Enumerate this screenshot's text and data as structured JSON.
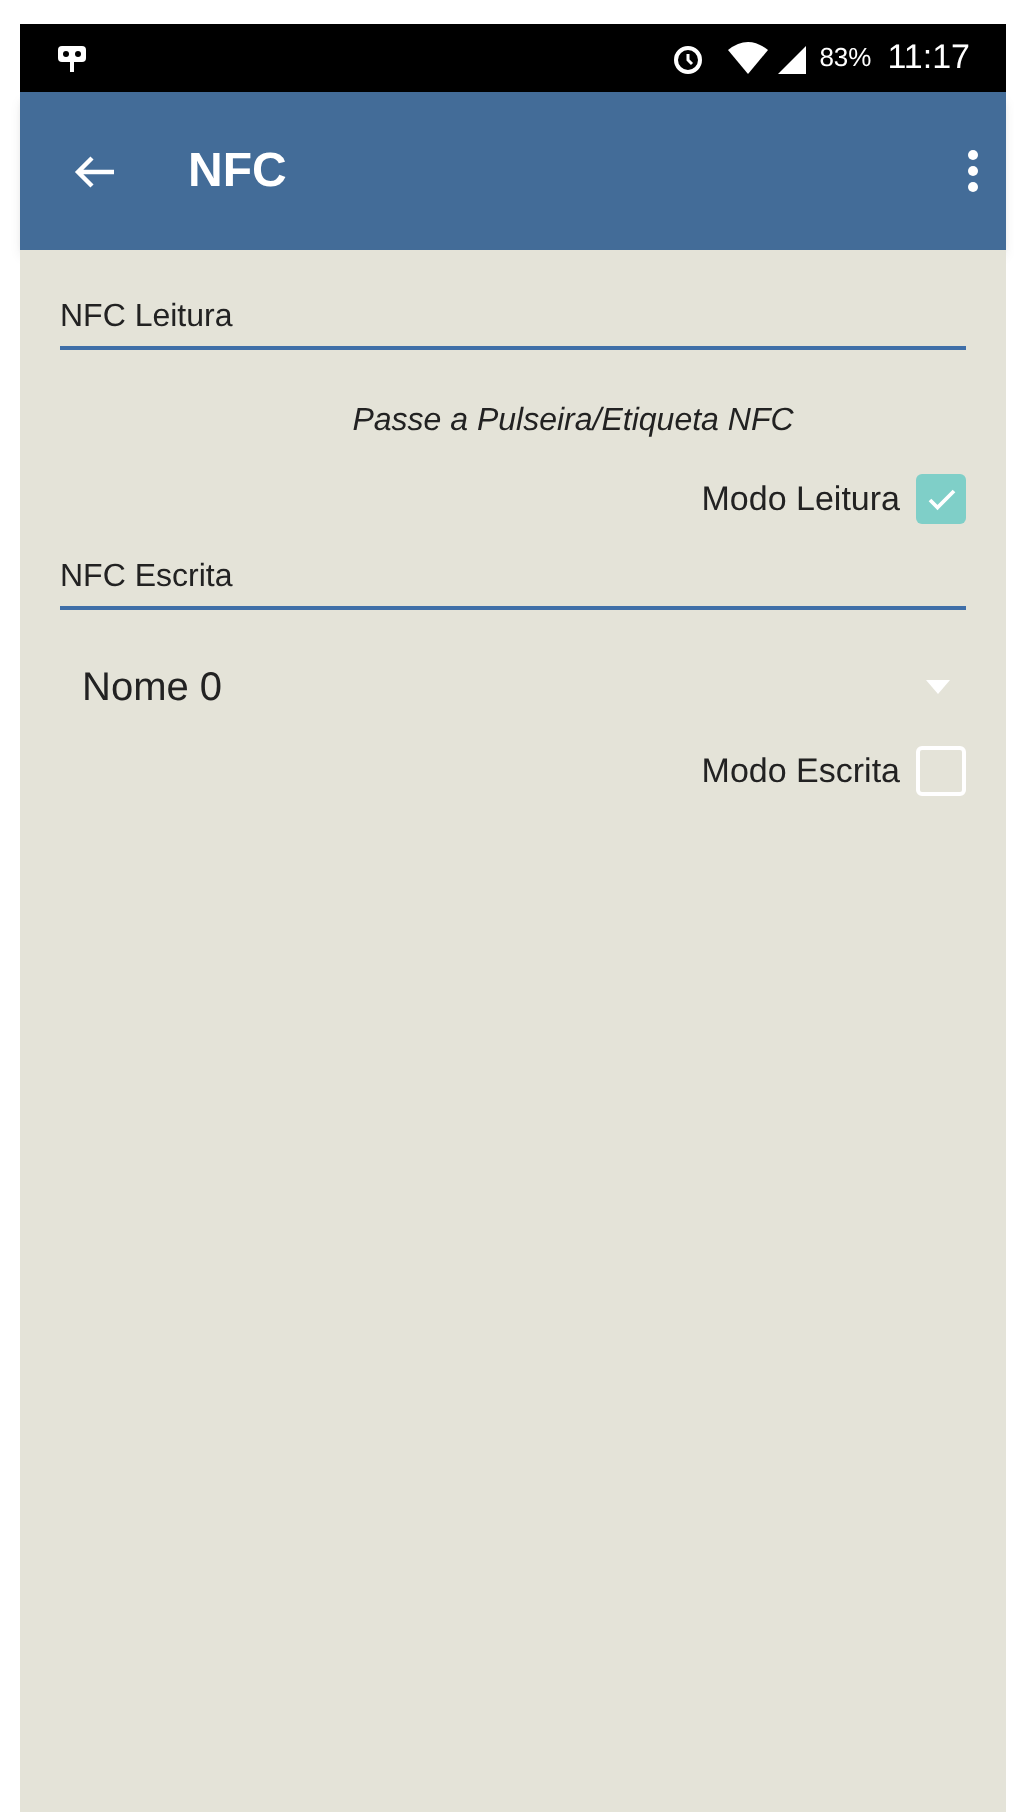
{
  "status_bar": {
    "battery": "83%",
    "time": "11:17"
  },
  "app_bar": {
    "title": "NFC"
  },
  "sections": [
    {
      "kind": "reading",
      "header": "NFC Leitura",
      "hint": "Passe a Pulseira/Etiqueta NFC",
      "checkbox": {
        "label": "Modo Leitura",
        "checked": true
      }
    },
    {
      "kind": "writing",
      "header": "NFC Escrita",
      "dropdown": {
        "value": "Nome 0"
      },
      "checkbox": {
        "label": "Modo Escrita",
        "checked": false
      }
    }
  ]
}
